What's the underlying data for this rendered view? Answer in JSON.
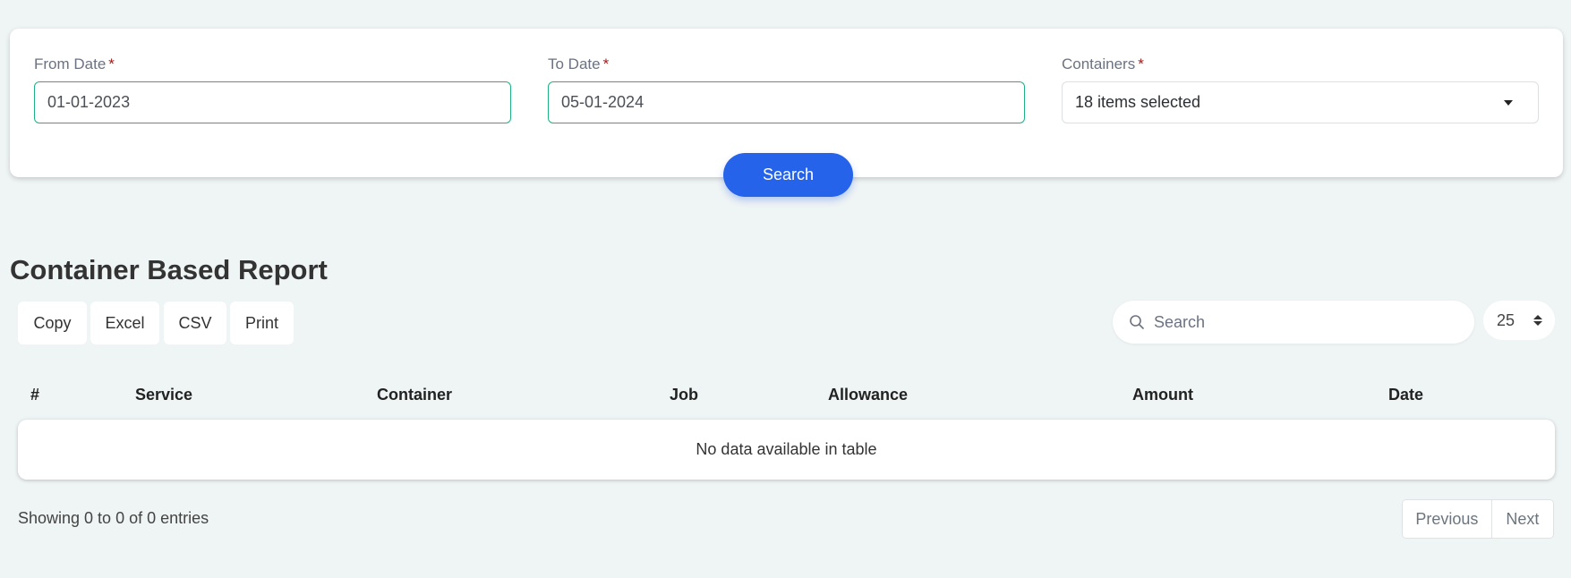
{
  "filters": {
    "from_date": {
      "label": "From Date",
      "required_mark": "*",
      "value": "01-01-2023"
    },
    "to_date": {
      "label": "To Date",
      "required_mark": "*",
      "value": "05-01-2024"
    },
    "containers": {
      "label": "Containers",
      "required_mark": "*",
      "value": "18 items selected",
      "icon": "caret-down-icon"
    },
    "search_button": "Search"
  },
  "report": {
    "title": "Container Based Report",
    "export_buttons": [
      "Copy",
      "Excel",
      "CSV",
      "Print"
    ],
    "search_placeholder": "Search",
    "page_length": "25",
    "columns": [
      "#",
      "Service",
      "Container",
      "Job",
      "Allowance",
      "Amount",
      "Date"
    ],
    "empty_message": "No data available in table",
    "info": "Showing 0 to 0 of 0 entries",
    "pagination": {
      "previous": "Previous",
      "next": "Next"
    }
  },
  "colors": {
    "accent_border": "#1fb184",
    "primary_button": "#2563eb",
    "required": "#a11b1b",
    "background": "#eff4f4"
  }
}
